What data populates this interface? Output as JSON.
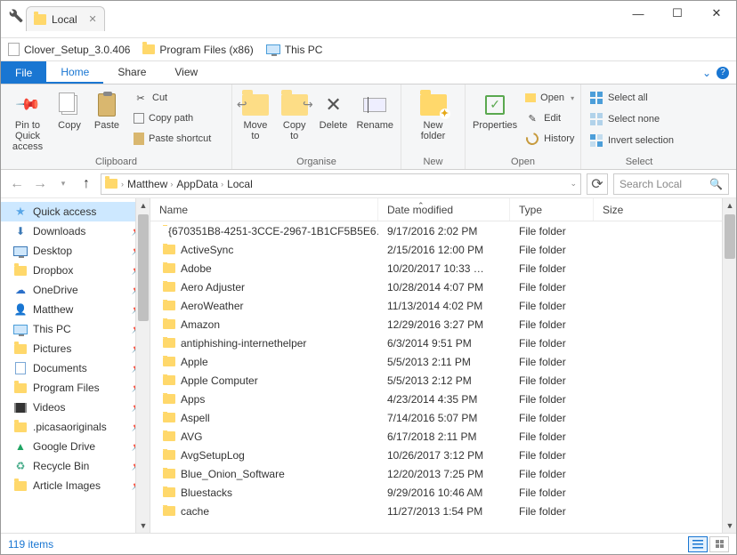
{
  "window": {
    "tab_title": "Local"
  },
  "shortcuts": [
    {
      "label": "Clover_Setup_3.0.406",
      "icon": "file"
    },
    {
      "label": "Program Files (x86)",
      "icon": "folder"
    },
    {
      "label": "This PC",
      "icon": "monitor"
    }
  ],
  "ribbon": {
    "tabs": {
      "file": "File",
      "home": "Home",
      "share": "Share",
      "view": "View"
    },
    "clipboard": {
      "label": "Clipboard",
      "pin": "Pin to Quick access",
      "copy": "Copy",
      "paste": "Paste",
      "cut": "Cut",
      "copy_path": "Copy path",
      "paste_shortcut": "Paste shortcut"
    },
    "organise": {
      "label": "Organise",
      "move_to": "Move to",
      "copy_to": "Copy to",
      "delete": "Delete",
      "rename": "Rename"
    },
    "new": {
      "label": "New",
      "new_folder": "New folder"
    },
    "open": {
      "label": "Open",
      "properties": "Properties",
      "open": "Open",
      "edit": "Edit",
      "history": "History"
    },
    "select": {
      "label": "Select",
      "select_all": "Select all",
      "select_none": "Select none",
      "invert": "Invert selection"
    }
  },
  "breadcrumb": {
    "segments": [
      "Matthew",
      "AppData",
      "Local"
    ]
  },
  "search": {
    "placeholder": "Search Local"
  },
  "columns": {
    "name": "Name",
    "date": "Date modified",
    "type": "Type",
    "size": "Size"
  },
  "sidebar": [
    {
      "label": "Quick access",
      "icon": "star",
      "selected": true,
      "pin": false
    },
    {
      "label": "Downloads",
      "icon": "download",
      "pin": true
    },
    {
      "label": "Desktop",
      "icon": "desktop",
      "pin": true
    },
    {
      "label": "Dropbox",
      "icon": "folder",
      "pin": true
    },
    {
      "label": "OneDrive",
      "icon": "cloud",
      "pin": true
    },
    {
      "label": "Matthew",
      "icon": "user",
      "pin": true
    },
    {
      "label": "This PC",
      "icon": "monitor",
      "pin": true
    },
    {
      "label": "Pictures",
      "icon": "folder",
      "pin": true
    },
    {
      "label": "Documents",
      "icon": "doc",
      "pin": true
    },
    {
      "label": "Program Files",
      "icon": "folder",
      "pin": true
    },
    {
      "label": "Videos",
      "icon": "video",
      "pin": true
    },
    {
      "label": ".picasaoriginals",
      "icon": "folder",
      "pin": true
    },
    {
      "label": "Google Drive",
      "icon": "gdrive",
      "pin": true
    },
    {
      "label": "Recycle Bin",
      "icon": "recycle",
      "pin": true
    },
    {
      "label": "Article Images",
      "icon": "folder",
      "pin": true
    }
  ],
  "files": [
    {
      "name": "{670351B8-4251-3CCE-2967-1B1CF5B5E6…",
      "date": "9/17/2016 2:02 PM",
      "type": "File folder"
    },
    {
      "name": "ActiveSync",
      "date": "2/15/2016 12:00 PM",
      "type": "File folder"
    },
    {
      "name": "Adobe",
      "date": "10/20/2017 10:33 …",
      "type": "File folder"
    },
    {
      "name": "Aero Adjuster",
      "date": "10/28/2014 4:07 PM",
      "type": "File folder"
    },
    {
      "name": "AeroWeather",
      "date": "11/13/2014 4:02 PM",
      "type": "File folder"
    },
    {
      "name": "Amazon",
      "date": "12/29/2016 3:27 PM",
      "type": "File folder"
    },
    {
      "name": "antiphishing-internethelper",
      "date": "6/3/2014 9:51 PM",
      "type": "File folder"
    },
    {
      "name": "Apple",
      "date": "5/5/2013 2:11 PM",
      "type": "File folder"
    },
    {
      "name": "Apple Computer",
      "date": "5/5/2013 2:12 PM",
      "type": "File folder"
    },
    {
      "name": "Apps",
      "date": "4/23/2014 4:35 PM",
      "type": "File folder"
    },
    {
      "name": "Aspell",
      "date": "7/14/2016 5:07 PM",
      "type": "File folder"
    },
    {
      "name": "AVG",
      "date": "6/17/2018 2:11 PM",
      "type": "File folder"
    },
    {
      "name": "AvgSetupLog",
      "date": "10/26/2017 3:12 PM",
      "type": "File folder"
    },
    {
      "name": "Blue_Onion_Software",
      "date": "12/20/2013 7:25 PM",
      "type": "File folder"
    },
    {
      "name": "Bluestacks",
      "date": "9/29/2016 10:46 AM",
      "type": "File folder"
    },
    {
      "name": "cache",
      "date": "11/27/2013 1:54 PM",
      "type": "File folder"
    }
  ],
  "status": {
    "count": "119 items"
  }
}
